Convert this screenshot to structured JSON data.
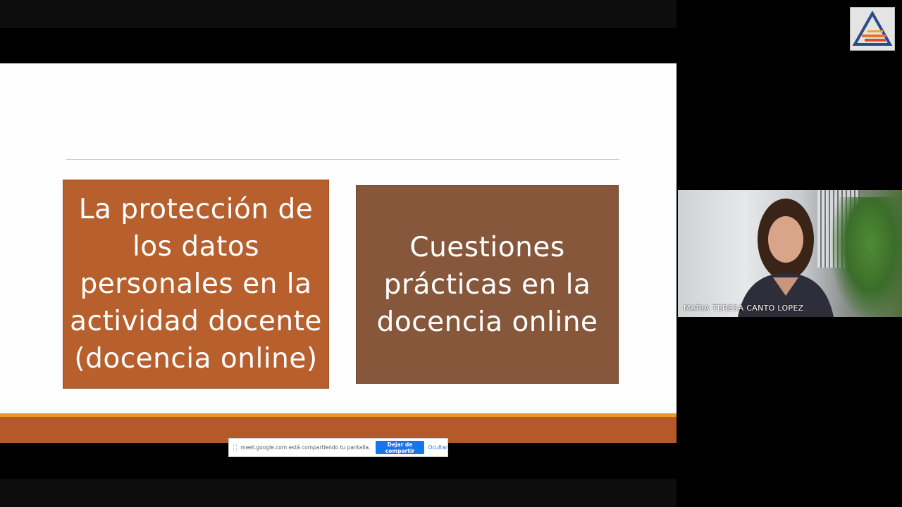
{
  "slide": {
    "left_box_lines": [
      "La protección de",
      "los datos",
      "personales en la",
      "actividad docente",
      "(docencia online)"
    ],
    "right_box_lines": [
      "Cuestiones",
      "prácticas en la",
      "docencia online"
    ]
  },
  "share_bar": {
    "message": "meet.google.com está compartiendo tu pantalla.",
    "stop_label": "Dejar de compartir",
    "hide_label": "Ocultar"
  },
  "participant": {
    "name": "MARIA TERESA CANTO LOPEZ"
  },
  "colors": {
    "left_box": "#b75f2d",
    "right_box": "#87573c",
    "accent_band": "#b5592a",
    "accent_line": "#e89a2a",
    "button_blue": "#1a73e8"
  }
}
